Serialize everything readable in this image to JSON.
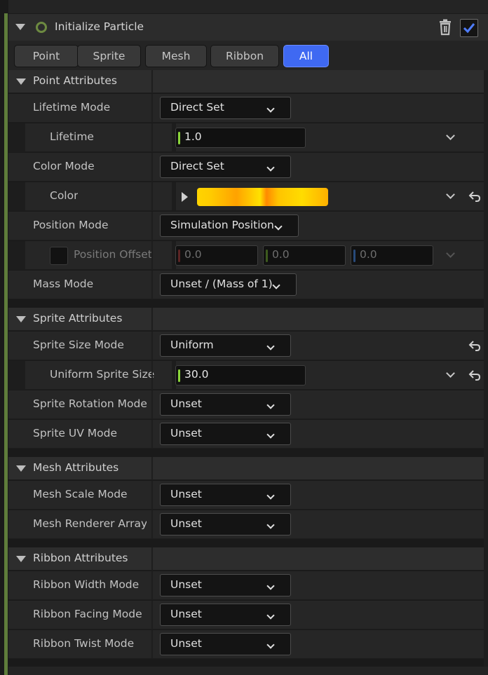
{
  "header": {
    "title": "Initialize Particle"
  },
  "tabs": [
    {
      "label": "Point"
    },
    {
      "label": "Sprite"
    },
    {
      "label": "Mesh"
    },
    {
      "label": "Ribbon"
    },
    {
      "label": "All",
      "active": true
    }
  ],
  "sections": {
    "point": {
      "label": "Point Attributes"
    },
    "sprite": {
      "label": "Sprite Attributes"
    },
    "mesh": {
      "label": "Mesh Attributes"
    },
    "ribbon": {
      "label": "Ribbon Attributes"
    }
  },
  "rows": {
    "lifetime_mode": {
      "label": "Lifetime Mode",
      "value": "Direct Set"
    },
    "lifetime": {
      "label": "Lifetime",
      "value": "1.0"
    },
    "color_mode": {
      "label": "Color Mode",
      "value": "Direct Set"
    },
    "color": {
      "label": "Color"
    },
    "position_mode": {
      "label": "Position Mode",
      "value": "Simulation Position"
    },
    "position_offset": {
      "label": "Position Offset",
      "x": "0.0",
      "y": "0.0",
      "z": "0.0"
    },
    "mass_mode": {
      "label": "Mass Mode",
      "value": "Unset / (Mass of 1)"
    },
    "sprite_size_mode": {
      "label": "Sprite Size Mode",
      "value": "Uniform"
    },
    "uniform_sprite_size": {
      "label": "Uniform Sprite Size",
      "value": "30.0"
    },
    "sprite_rotation_mode": {
      "label": "Sprite Rotation Mode",
      "value": "Unset"
    },
    "sprite_uv_mode": {
      "label": "Sprite UV Mode",
      "value": "Unset"
    },
    "mesh_scale_mode": {
      "label": "Mesh Scale Mode",
      "value": "Unset"
    },
    "mesh_renderer_array": {
      "label": "Mesh Renderer Array V",
      "value": "Unset"
    },
    "ribbon_width_mode": {
      "label": "Ribbon Width Mode",
      "value": "Unset"
    },
    "ribbon_facing_mode": {
      "label": "Ribbon Facing Mode",
      "value": "Unset"
    },
    "ribbon_twist_mode": {
      "label": "Ribbon Twist Mode",
      "value": "Unset"
    }
  },
  "colors": {
    "accent": "#3f69f2",
    "green": "#5f7d3b",
    "x_axis": "#b83a3a",
    "y_axis": "#5e8c2a",
    "z_axis": "#3a6ab8",
    "value_marker": "#8bd63a"
  },
  "icons": {
    "module": "ring-icon",
    "delete": "trash-icon",
    "enabled": "checkmark-icon",
    "reset": "undo-arrow-icon"
  }
}
